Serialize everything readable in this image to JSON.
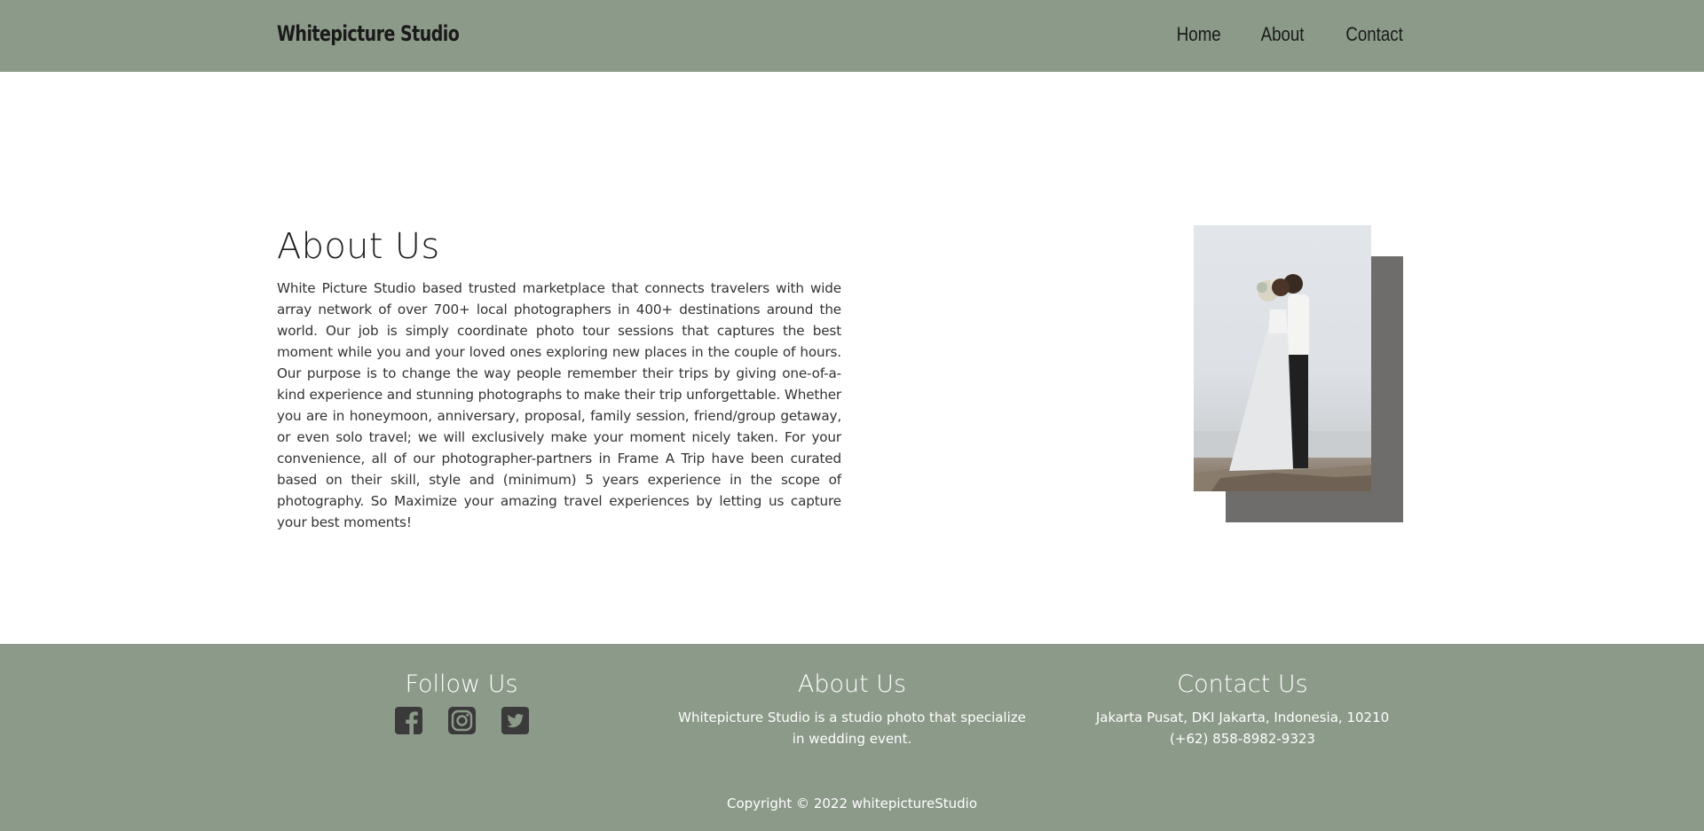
{
  "header": {
    "brand": "Whitepicture Studio",
    "nav": [
      "Home",
      "About",
      "Contact"
    ]
  },
  "about": {
    "title": "About Us",
    "body": "White Picture Studio based trusted marketplace that connects travelers with wide array network of over 700+ local photographers in 400+ destinations around the world. Our job is simply coordinate photo tour sessions that captures the best moment while you and your loved ones exploring new places in the couple of hours. Our purpose is to change the way people remember their trips by giving one-of-a-kind experience and stunning photographs to make their trip unforgettable. Whether you are in honeymoon, anniversary, proposal, family session, friend/group getaway, or even solo travel; we will exclusively make your moment nicely taken. For your convenience, all of our photographer-partners in Frame A Trip have been curated based on their skill, style and (minimum) 5 years experience in the scope of photography. So Maximize your amazing travel experiences by letting us capture your best moments!",
    "image_alt": "wedding couple photo"
  },
  "footer": {
    "follow": {
      "title": "Follow Us",
      "icons": [
        "facebook-icon",
        "instagram-icon",
        "twitter-icon"
      ]
    },
    "about": {
      "title": "About Us",
      "text": "Whitepicture Studio is a studio photo that specialize in wedding event."
    },
    "contact": {
      "title": "Contact Us",
      "address": "Jakarta Pusat, DKI Jakarta, Indonesia, 10210",
      "phone": "(+62) 858-8982-9323"
    },
    "copyright": "Copyright © 2022 whitepictureStudio"
  },
  "colors": {
    "header_bg": "#8c9a89",
    "footer_bg": "#8c9a89",
    "photo_shadow": "#6e6d6b",
    "social_icon": "#3a3a3a"
  }
}
